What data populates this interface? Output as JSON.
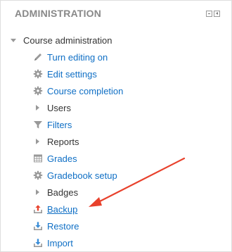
{
  "block": {
    "title": "ADMINISTRATION",
    "controls": [
      {
        "icon": "minimize-icon"
      },
      {
        "icon": "dock-icon"
      }
    ]
  },
  "tree": {
    "root_label": "Course administration",
    "items": [
      {
        "label": "Turn editing on",
        "icon": "pencil-icon",
        "kind": "link"
      },
      {
        "label": "Edit settings",
        "icon": "gear-icon",
        "kind": "link"
      },
      {
        "label": "Course completion",
        "icon": "gear-icon",
        "kind": "link"
      },
      {
        "label": "Users",
        "icon": "expand-triangle-icon",
        "kind": "folder"
      },
      {
        "label": "Filters",
        "icon": "filter-icon",
        "kind": "link"
      },
      {
        "label": "Reports",
        "icon": "expand-triangle-icon",
        "kind": "folder"
      },
      {
        "label": "Grades",
        "icon": "grades-table-icon",
        "kind": "link"
      },
      {
        "label": "Gradebook setup",
        "icon": "gear-icon",
        "kind": "link"
      },
      {
        "label": "Badges",
        "icon": "expand-triangle-icon",
        "kind": "folder"
      },
      {
        "label": "Backup",
        "icon": "upload-tray-icon",
        "kind": "link",
        "highlighted": true
      },
      {
        "label": "Restore",
        "icon": "download-tray-icon",
        "kind": "link"
      },
      {
        "label": "Import",
        "icon": "download-tray-icon",
        "kind": "link"
      }
    ]
  },
  "annotation": {
    "icon": "red-arrow-icon",
    "color": "#e8412c"
  },
  "colors": {
    "link": "#0f6fc5",
    "title": "#888888",
    "text": "#333333",
    "icon": "#999999"
  }
}
